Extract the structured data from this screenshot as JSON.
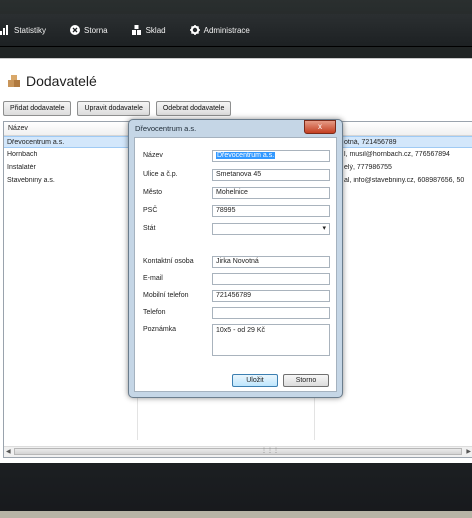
{
  "nav": {
    "items": [
      {
        "label": "Statistiky",
        "icon": "bar-chart-icon"
      },
      {
        "label": "Storna",
        "icon": "cancel-circle-icon"
      },
      {
        "label": "Sklad",
        "icon": "warehouse-icon"
      },
      {
        "label": "Administrace",
        "icon": "gear-icon"
      }
    ]
  },
  "page": {
    "title": "Dodavatelé",
    "title_icon": "boxes-icon"
  },
  "toolbar": {
    "add_label": "Přidat dodavatele",
    "edit_label": "Upravit dodavatele",
    "remove_label": "Odebrat dodavatele"
  },
  "grid": {
    "header_name": "Název",
    "rows": [
      {
        "name": "Dřevocentrum a.s.",
        "contact": "otná, 721456789",
        "selected": true
      },
      {
        "name": "Hornbach",
        "contact": "l, musil@hornbach.cz, 776567894",
        "selected": false
      },
      {
        "name": "Instalatér",
        "contact": "elý, 777986755",
        "selected": false
      },
      {
        "name": "Stavebniny a.s.",
        "contact": "al, info@stavebniny.cz, 608987656, 50",
        "selected": false
      }
    ]
  },
  "dialog": {
    "title": "Dřevocentrum a.s.",
    "close_label": "x",
    "fields": {
      "nazev": {
        "label": "Název",
        "value": "Dřevocentrum a.s."
      },
      "ulice": {
        "label": "Ulice a č.p.",
        "value": "Smetanova 45"
      },
      "mesto": {
        "label": "Město",
        "value": "Mohelnice"
      },
      "psc": {
        "label": "PSČ",
        "value": "78995"
      },
      "stat": {
        "label": "Stát",
        "value": ""
      },
      "kontakt": {
        "label": "Kontaktní osoba",
        "value": "Jirka Novotná"
      },
      "email": {
        "label": "E-mail",
        "value": ""
      },
      "mobil": {
        "label": "Mobilní telefon",
        "value": "721456789"
      },
      "telefon": {
        "label": "Telefon",
        "value": ""
      },
      "poznamka": {
        "label": "Poznámka",
        "value": "10x5 - od 29 Kč"
      }
    },
    "save_label": "Uložit",
    "cancel_label": "Storno"
  },
  "colors": {
    "selection": "#d3e7fb",
    "dialog_frame": "#c5d6e6",
    "close_red": "#c43f22",
    "nav_bg": "#1d2123"
  }
}
